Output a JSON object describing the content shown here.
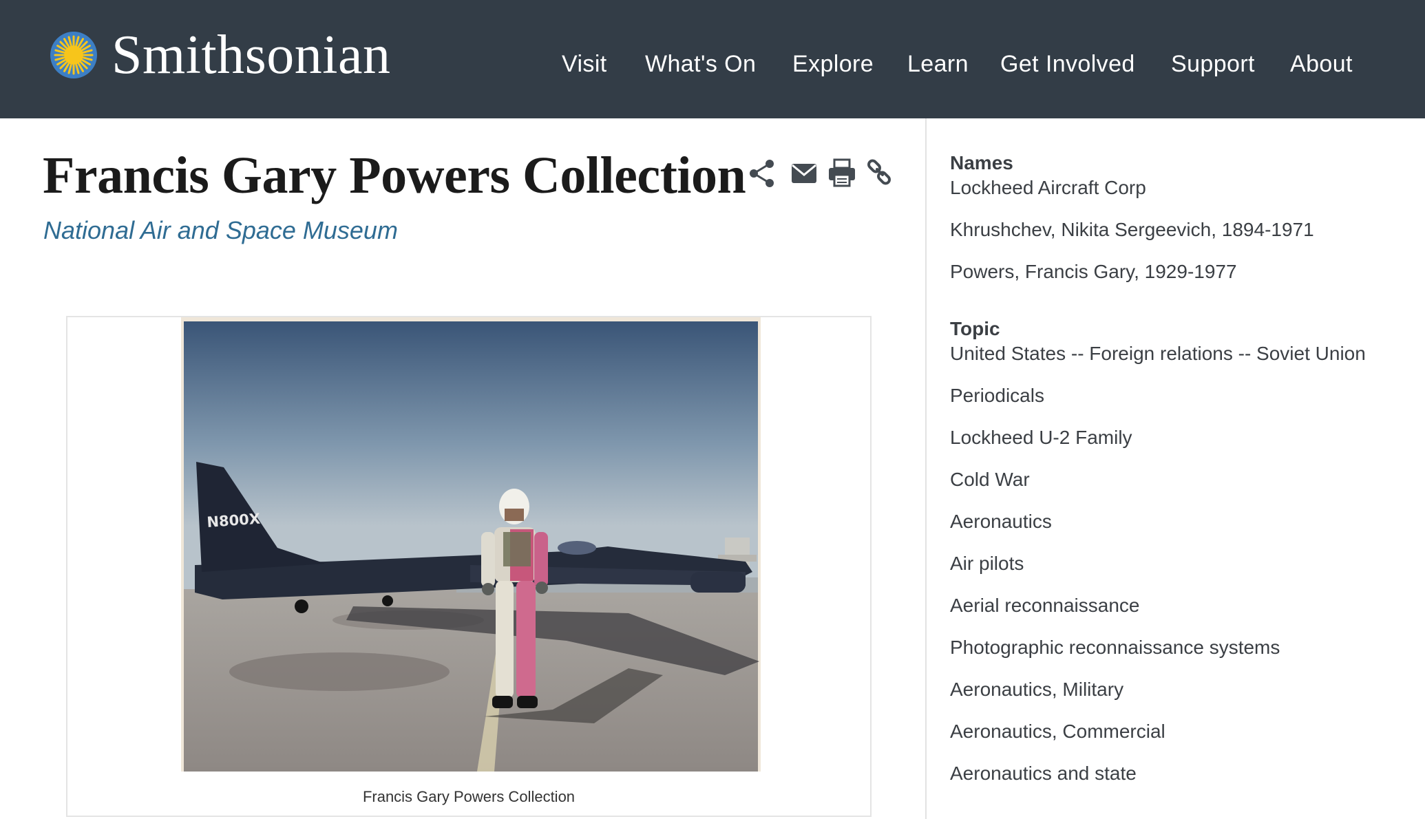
{
  "header": {
    "brand": "Smithsonian",
    "nav": [
      "Visit",
      "What's On",
      "Explore",
      "Learn",
      "Get Involved",
      "Support",
      "About"
    ]
  },
  "record": {
    "title": "Francis Gary Powers Collection",
    "unit": "National Air and Space Museum",
    "tools": [
      "share-icon",
      "email-icon",
      "print-icon",
      "link-icon"
    ],
    "caption": "Francis Gary Powers Collection",
    "photo_tail_marking": "N800X"
  },
  "sidebar": {
    "names_heading": "Names",
    "names": [
      "Lockheed Aircraft Corp",
      "Khrushchev, Nikita Sergeevich, 1894-1971",
      "Powers, Francis Gary, 1929-1977"
    ],
    "topic_heading": "Topic",
    "topics": [
      "United States -- Foreign relations -- Soviet Union",
      "Periodicals",
      "Lockheed U-2 Family",
      "Cold War",
      "Aeronautics",
      "Air pilots",
      "Aerial reconnaissance",
      "Photographic reconnaissance systems",
      "Aeronautics, Military",
      "Aeronautics, Commercial",
      "Aeronautics and state"
    ]
  },
  "colors": {
    "header_bg": "#333d47",
    "link": "#2f6c93",
    "sun_blue": "#3d7fc4",
    "sun_yellow": "#f7c51b"
  }
}
